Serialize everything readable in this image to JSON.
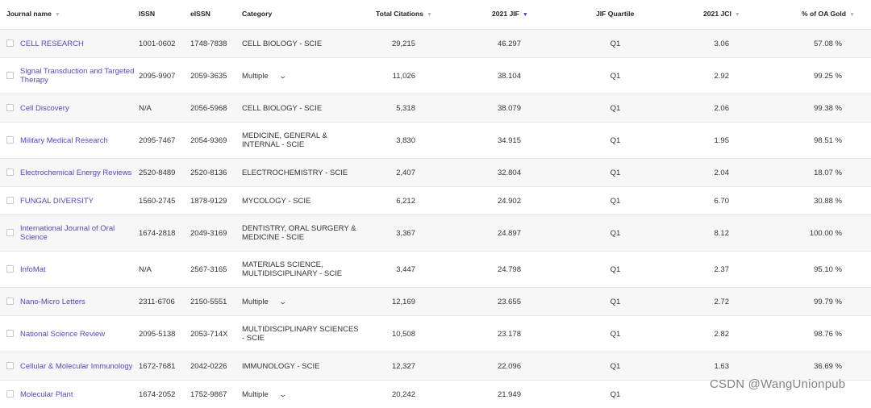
{
  "header": {
    "journal_name": "Journal name",
    "issn": "ISSN",
    "eissn": "eISSN",
    "category": "Category",
    "total_citations": "Total Citations",
    "jif": "2021 JIF",
    "jif_quartile": "JIF Quartile",
    "jci": "2021 JCI",
    "oa_gold": "% of OA Gold"
  },
  "rows": [
    {
      "name": "CELL RESEARCH",
      "issn": "1001-0602",
      "eissn": "1748-7838",
      "category": "CELL BIOLOGY - SCIE",
      "citations": "29,215",
      "jif": "46.297",
      "quartile": "Q1",
      "jci": "3.06",
      "oa": "57.08 %"
    },
    {
      "name": "Signal Transduction and Targeted Therapy",
      "issn": "2095-9907",
      "eissn": "2059-3635",
      "category": "Multiple",
      "citations": "11,026",
      "jif": "38.104",
      "quartile": "Q1",
      "jci": "2.92",
      "oa": "99.25 %"
    },
    {
      "name": "Cell Discovery",
      "issn": "N/A",
      "eissn": "2056-5968",
      "category": "CELL BIOLOGY - SCIE",
      "citations": "5,318",
      "jif": "38.079",
      "quartile": "Q1",
      "jci": "2.06",
      "oa": "99.38 %"
    },
    {
      "name": "Military Medical Research",
      "issn": "2095-7467",
      "eissn": "2054-9369",
      "category": "MEDICINE, GENERAL & INTERNAL - SCIE",
      "citations": "3,830",
      "jif": "34.915",
      "quartile": "Q1",
      "jci": "1.95",
      "oa": "98.51 %"
    },
    {
      "name": "Electrochemical Energy Reviews",
      "issn": "2520-8489",
      "eissn": "2520-8136",
      "category": "ELECTROCHEMISTRY - SCIE",
      "citations": "2,407",
      "jif": "32.804",
      "quartile": "Q1",
      "jci": "2.04",
      "oa": "18.07 %"
    },
    {
      "name": "FUNGAL DIVERSITY",
      "issn": "1560-2745",
      "eissn": "1878-9129",
      "category": "MYCOLOGY - SCIE",
      "citations": "6,212",
      "jif": "24.902",
      "quartile": "Q1",
      "jci": "6.70",
      "oa": "30.88 %"
    },
    {
      "name": "International Journal of Oral Science",
      "issn": "1674-2818",
      "eissn": "2049-3169",
      "category": "DENTISTRY, ORAL SURGERY & MEDICINE - SCIE",
      "citations": "3,367",
      "jif": "24.897",
      "quartile": "Q1",
      "jci": "8.12",
      "oa": "100.00 %"
    },
    {
      "name": "InfoMat",
      "issn": "N/A",
      "eissn": "2567-3165",
      "category": "MATERIALS SCIENCE, MULTIDISCIPLINARY - SCIE",
      "citations": "3,447",
      "jif": "24.798",
      "quartile": "Q1",
      "jci": "2.37",
      "oa": "95.10 %"
    },
    {
      "name": "Nano-Micro Letters",
      "issn": "2311-6706",
      "eissn": "2150-5551",
      "category": "Multiple",
      "citations": "12,169",
      "jif": "23.655",
      "quartile": "Q1",
      "jci": "2.72",
      "oa": "99.79 %"
    },
    {
      "name": "National Science Review",
      "issn": "2095-5138",
      "eissn": "2053-714X",
      "category": "MULTIDISCIPLINARY SCIENCES - SCIE",
      "citations": "10,508",
      "jif": "23.178",
      "quartile": "Q1",
      "jci": "2.82",
      "oa": "98.76 %"
    },
    {
      "name": "Cellular & Molecular Immunology",
      "issn": "1672-7681",
      "eissn": "2042-0226",
      "category": "IMMUNOLOGY - SCIE",
      "citations": "12,327",
      "jif": "22.096",
      "quartile": "Q1",
      "jci": "1.63",
      "oa": "36.69 %"
    },
    {
      "name": "Molecular Plant",
      "issn": "1674-2052",
      "eissn": "1752-9867",
      "category": "Multiple",
      "citations": "20,242",
      "jif": "21.949",
      "quartile": "Q1",
      "jci": "",
      "oa": ""
    }
  ],
  "watermark": "CSDN @WangUnionpub",
  "icons": {
    "sort": "sort-caret-down-icon",
    "expand": "chevron-down-icon"
  },
  "colors": {
    "link": "#5e43c2",
    "active_sort": "#5b3cc4",
    "row_alt": "#f7f7f7",
    "border": "#e6e6e6"
  }
}
